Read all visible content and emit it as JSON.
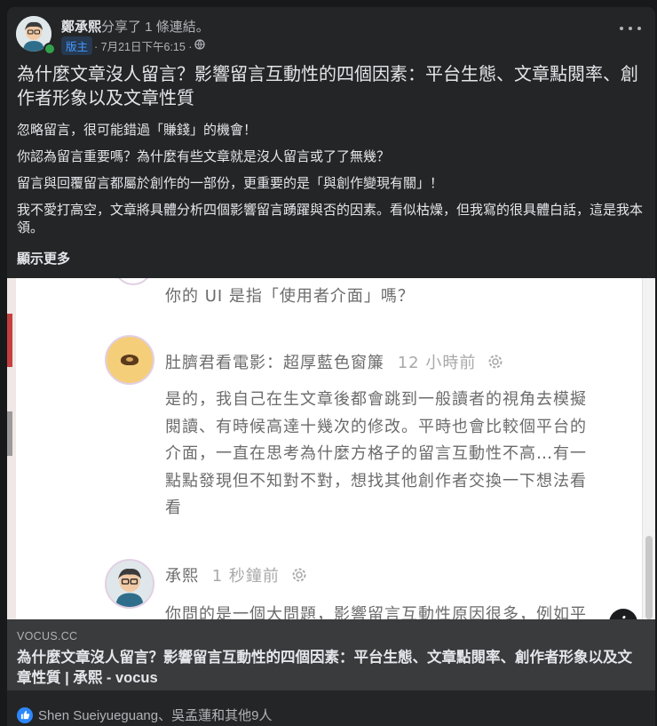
{
  "post": {
    "author_name": "鄭承熙",
    "action_text": "分享了 1 條連結。",
    "badge": "版主",
    "timestamp": "· 7月21日下午6:15 ·",
    "privacy_icon": "globe-icon",
    "more_icon": "more-options-icon",
    "title": "為什麼文章沒人留言？影響留言互動性的四個因素：平台生態、文章點閱率、創作者形象以及文章性質",
    "paragraphs": [
      "忽略留言，很可能錯過「賺錢」的機會！",
      "你認為留言重要嗎？為什麼有些文章就是沒人留言或了了無幾？",
      "留言與回覆留言都屬於創作的一部份，更重要的是「與創作變現有關」！",
      "我不愛打高空，文章將具體分析四個影響留言踴躍與否的因素。看似枯燥，但我寫的很具體白話，這是我本領。"
    ],
    "see_more": "顯示更多"
  },
  "link_preview": {
    "image_comments": {
      "top_reply": "你的 UI 是指「使用者介面」嗎？",
      "comment1_author": "肚臍君看電影：超厚藍色窗簾",
      "comment1_time": "12 小時前",
      "comment1_lines": [
        "是的，我自己在生文章後都會跳到一般讀者的視角去模擬",
        "閱讀、有時候高達十幾次的修改。平時也會比較個平台的",
        "介面，一直在思考為什麼方格子的留言互動性不高…有一",
        "點點發現但不知對不對，想找其他創作者交換一下想法看",
        "看"
      ],
      "comment2_author": "承熙",
      "comment2_time": "1 秒鐘前",
      "comment2_line": "你問的是一個大問題，影響留言互動性原因很多，例如平"
    },
    "info_icon": "i",
    "domain": "VOCUS.CC",
    "title": "為什麼文章沒人留言？影響留言互動性的四個因素：平台生態、文章點閱率、創作者形象以及文章性質 | 承熙 - vocus"
  },
  "reactions": {
    "icon": "like-icon",
    "text": "Shen Sueiyueguang、吳孟蓮和其他9人"
  },
  "colors": {
    "background": "#18191a",
    "card": "#242526",
    "link_footer": "#3a3b3c",
    "badge_text": "#4599ff",
    "like": "#2d88ff"
  }
}
